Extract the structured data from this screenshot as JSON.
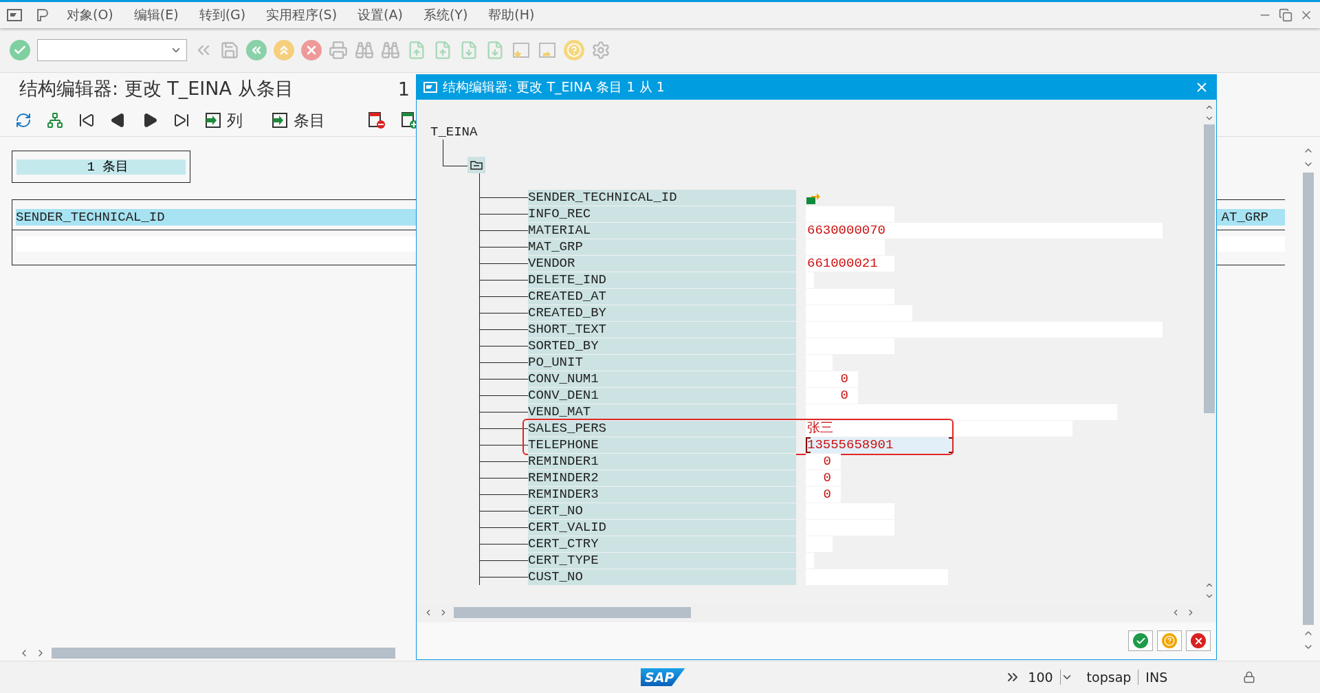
{
  "menu_bar": {
    "items": [
      "对象(O)",
      "编辑(E)",
      "转到(G)",
      "实用程序(S)",
      "设置(A)",
      "系统(Y)",
      "帮助(H)"
    ]
  },
  "screen_title": {
    "text": "结构编辑器: 更改 T_EINA 从条目",
    "count": "1"
  },
  "app_toolbar": {
    "buttons": [
      {
        "label": "列"
      },
      {
        "label": "条目"
      }
    ]
  },
  "entry_count": "1 条目",
  "table": {
    "header_left": "SENDER_TECHNICAL_ID",
    "header_right": "AT_GRP"
  },
  "dialog": {
    "title": "结构编辑器: 更改 T_EINA 条目 1 从 1",
    "root": "T_EINA",
    "fields": [
      {
        "name": "SENDER_TECHNICAL_ID",
        "kind": "icon",
        "highlighted": false
      },
      {
        "name": "INFO_REC",
        "kind": "text",
        "focused": false,
        "highlighted": false
      },
      {
        "name": "MATERIAL",
        "kind": "text",
        "value": "6630000070",
        "focused": false,
        "highlighted": false
      },
      {
        "name": "MAT_GRP",
        "kind": "text",
        "focused": false,
        "highlighted": false
      },
      {
        "name": "VENDOR",
        "kind": "text",
        "value": "661000021",
        "focused": false,
        "highlighted": false
      },
      {
        "name": "DELETE_IND",
        "kind": "text",
        "focused": false,
        "highlighted": false
      },
      {
        "name": "CREATED_AT",
        "kind": "text",
        "focused": false,
        "highlighted": false
      },
      {
        "name": "CREATED_BY",
        "kind": "text",
        "focused": false,
        "highlighted": false
      },
      {
        "name": "SHORT_TEXT",
        "kind": "text",
        "focused": false,
        "highlighted": false
      },
      {
        "name": "SORTED_BY",
        "kind": "text",
        "focused": false,
        "highlighted": false
      },
      {
        "name": "PO_UNIT",
        "kind": "text",
        "focused": false,
        "highlighted": false
      },
      {
        "name": "CONV_NUM1",
        "kind": "number",
        "value": "0",
        "focused": false,
        "highlighted": false
      },
      {
        "name": "CONV_DEN1",
        "kind": "number",
        "value": "0",
        "focused": false,
        "highlighted": false
      },
      {
        "name": "VEND_MAT",
        "kind": "text",
        "focused": false,
        "highlighted": false
      },
      {
        "name": "SALES_PERS",
        "kind": "text",
        "value": "张三",
        "focused": false,
        "highlighted": true
      },
      {
        "name": "TELEPHONE",
        "kind": "text",
        "value": "13555658901",
        "focused": true,
        "highlighted": true
      },
      {
        "name": "REMINDER1",
        "kind": "number",
        "value": "0",
        "focused": false,
        "highlighted": false
      },
      {
        "name": "REMINDER2",
        "kind": "number",
        "value": "0",
        "focused": false,
        "highlighted": false
      },
      {
        "name": "REMINDER3",
        "kind": "number",
        "value": "0",
        "focused": false,
        "highlighted": false
      },
      {
        "name": "CERT_NO",
        "kind": "text",
        "focused": false,
        "highlighted": false
      },
      {
        "name": "CERT_VALID",
        "kind": "text",
        "focused": false,
        "highlighted": false
      },
      {
        "name": "CERT_CTRY",
        "kind": "text",
        "focused": false,
        "highlighted": false
      },
      {
        "name": "CERT_TYPE",
        "kind": "text",
        "focused": false,
        "highlighted": false
      },
      {
        "name": "CUST_NO",
        "kind": "text",
        "focused": false,
        "highlighted": false
      }
    ]
  },
  "status_bar": {
    "logo": "SAP",
    "zoom": "100",
    "system": "topsap",
    "mode": "INS"
  }
}
